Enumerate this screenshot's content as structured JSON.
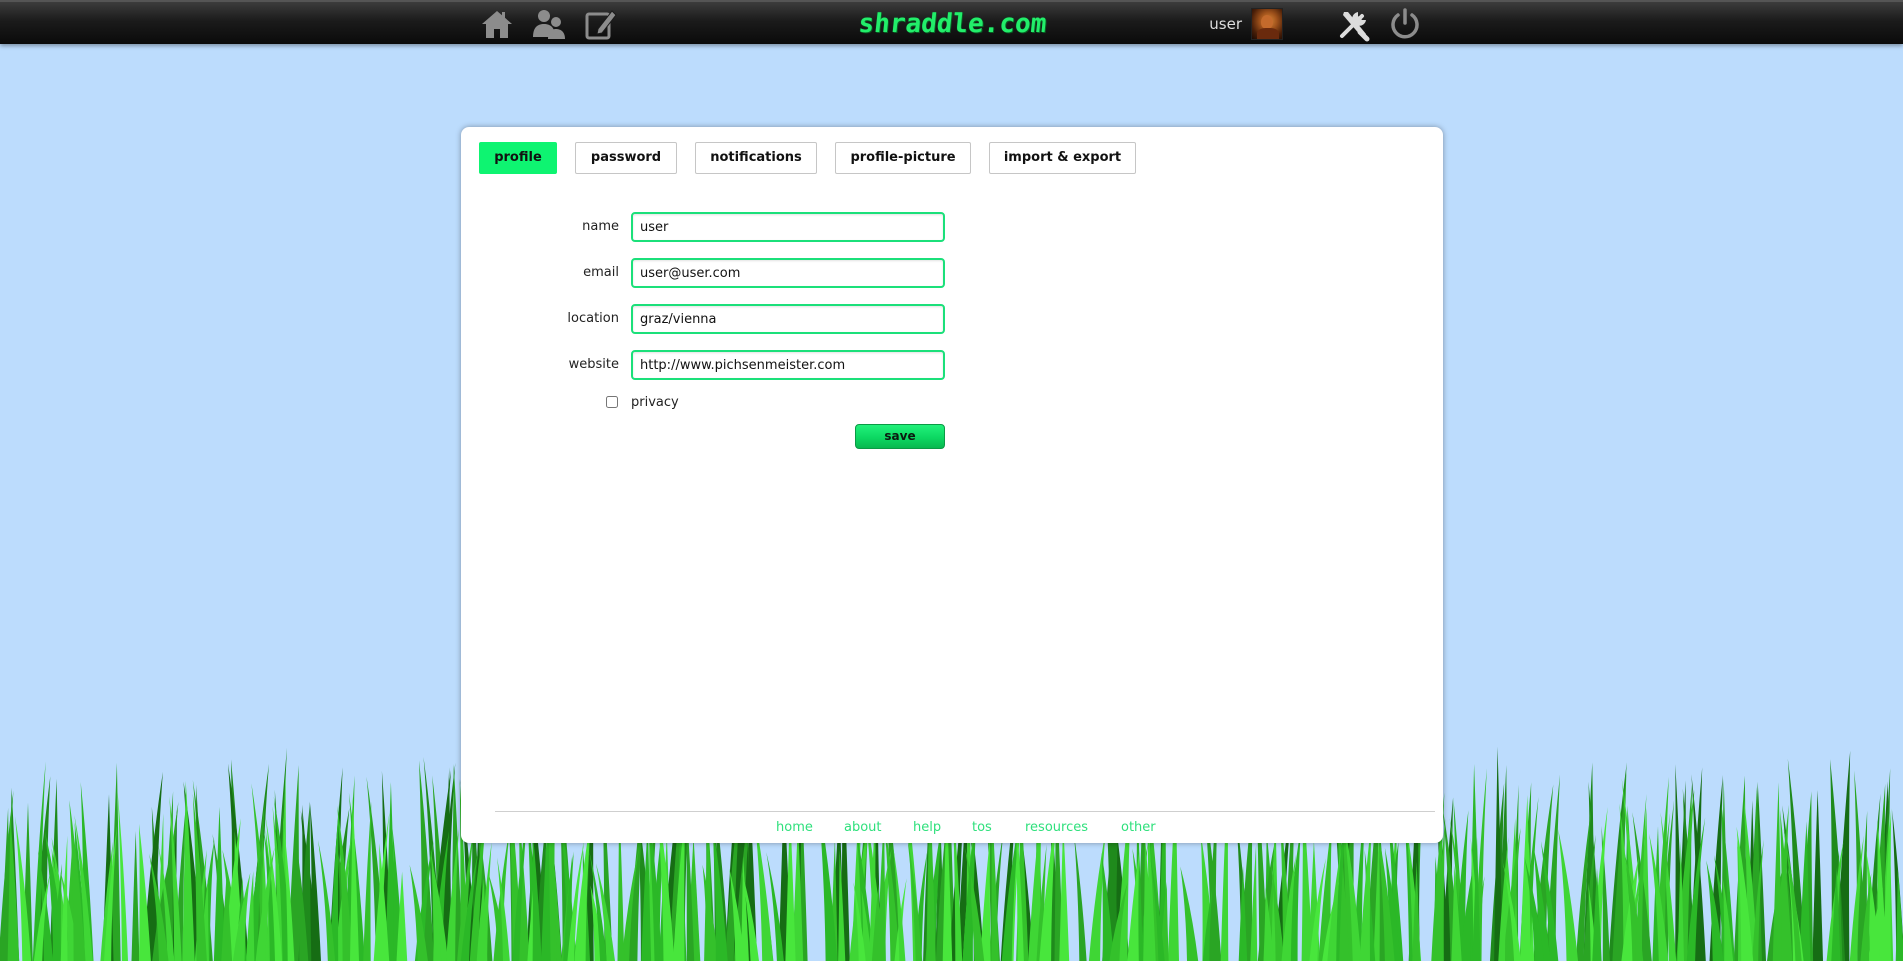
{
  "header": {
    "logo": "shraddle.com",
    "username": "user",
    "icons": {
      "home": "home-icon",
      "friends": "friends-icon",
      "write": "edit-icon",
      "settings": "tools-icon",
      "logout": "power-icon"
    }
  },
  "tabs": [
    {
      "label": "profile",
      "active": true
    },
    {
      "label": "password",
      "active": false
    },
    {
      "label": "notifications",
      "active": false
    },
    {
      "label": "profile-picture",
      "active": false
    },
    {
      "label": "import & export",
      "active": false
    }
  ],
  "form": {
    "name": {
      "label": "name",
      "value": "user"
    },
    "email": {
      "label": "email",
      "value": "user@user.com"
    },
    "location": {
      "label": "location",
      "value": "graz/vienna"
    },
    "website": {
      "label": "website",
      "value": "http://www.pichsenmeister.com"
    },
    "privacy": {
      "label": "privacy",
      "checked": false
    },
    "save_label": "save"
  },
  "footer": {
    "links": [
      "home",
      "about",
      "help",
      "tos",
      "resources",
      "other"
    ]
  },
  "colors": {
    "accent": "#0ef471",
    "background": "#bcdcfd",
    "link": "#2fe07c"
  }
}
